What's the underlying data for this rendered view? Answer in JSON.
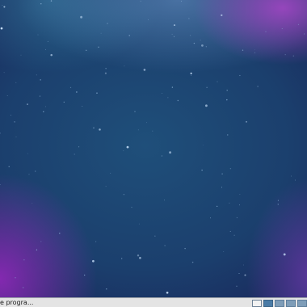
{
  "taskbar": {
    "launcher_text": "e progra...",
    "tray_items": [
      {
        "name": "show-desktop-icon",
        "state": "plain"
      },
      {
        "name": "workspace-1",
        "state": "active"
      },
      {
        "name": "workspace-2",
        "state": "ws"
      },
      {
        "name": "workspace-3",
        "state": "ws"
      },
      {
        "name": "workspace-4",
        "state": "ws"
      }
    ]
  },
  "colors": {
    "sky_base": "#1b3f6d",
    "nebula_purple": "#a846c8",
    "nebula_teal": "#3c96b4",
    "taskbar_bg": "#e4e4e4",
    "workspace_active": "#4a7ba6"
  }
}
